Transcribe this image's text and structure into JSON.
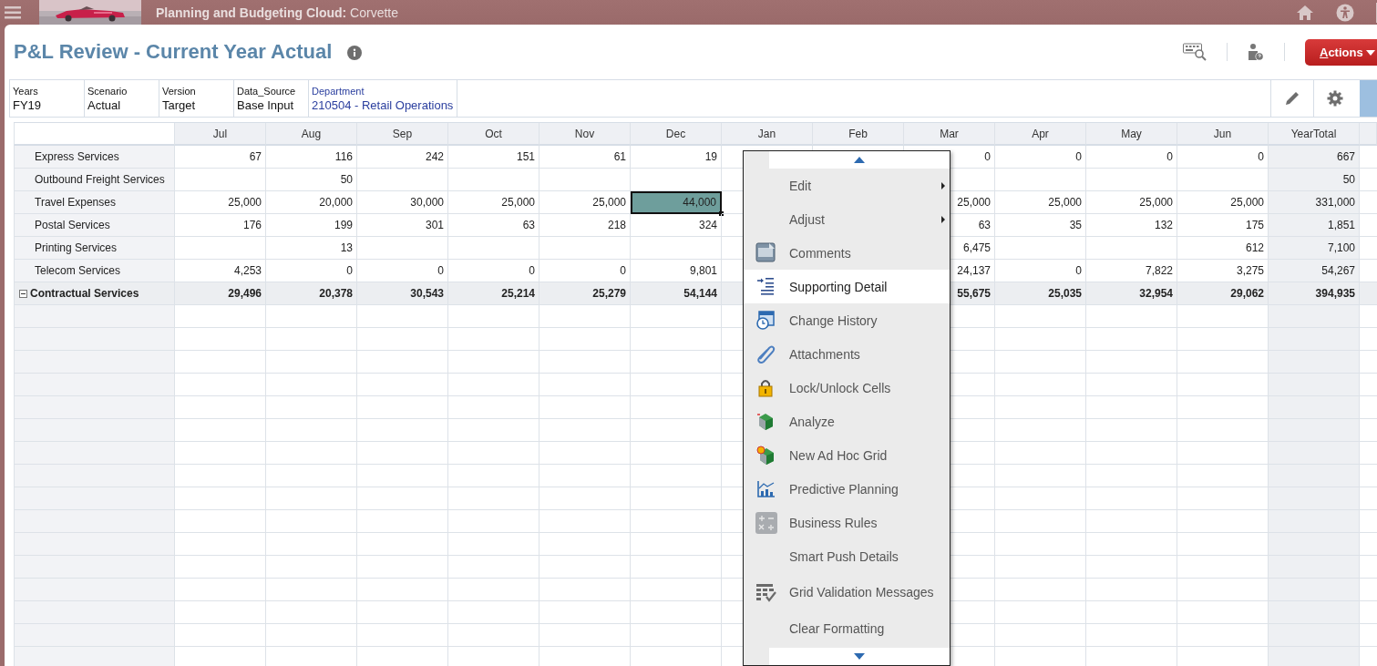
{
  "app_bar": {
    "title": "**Planning and Budgeting Cloud:** Corvette"
  },
  "form": {
    "title": "P&L Review - Current Year Actual",
    "actions_button": "Actions"
  },
  "pov": [
    {
      "label": "Years",
      "value": "FY19",
      "kind": "fixed"
    },
    {
      "label": "Scenario",
      "value": "Actual",
      "kind": "fixed"
    },
    {
      "label": "Version",
      "value": "Target",
      "kind": "fixed"
    },
    {
      "label": "Data_Source",
      "value": "Base Input",
      "kind": "fixed"
    },
    {
      "label": "Department",
      "value": "210504 - Retail Operations",
      "kind": "selectable"
    }
  ],
  "grid": {
    "columns": [
      "Jul",
      "Aug",
      "Sep",
      "Oct",
      "Nov",
      "Dec",
      "Jan",
      "Feb",
      "Mar",
      "Apr",
      "May",
      "Jun",
      "YearTotal"
    ],
    "rows": [
      {
        "label": "Express Services",
        "kind": "member",
        "cells": [
          {
            "value": "67",
            "selected": false
          },
          {
            "value": "116",
            "selected": false
          },
          {
            "value": "242",
            "selected": false
          },
          {
            "value": "151",
            "selected": false
          },
          {
            "value": "61",
            "selected": false
          },
          {
            "value": "19",
            "selected": false
          },
          null,
          null,
          {
            "value": "0",
            "selected": false
          },
          {
            "value": "0",
            "selected": false
          },
          {
            "value": "0",
            "selected": false
          },
          {
            "value": "0",
            "selected": false
          },
          {
            "value": "667",
            "selected": false
          }
        ]
      },
      {
        "label": "Outbound Freight Services",
        "kind": "member",
        "cells": [
          {
            "selected": false
          },
          {
            "value": "50",
            "selected": false
          },
          {
            "selected": false
          },
          {
            "selected": false
          },
          {
            "selected": false
          },
          {
            "selected": false
          },
          null,
          null,
          {
            "selected": false
          },
          {
            "selected": false
          },
          {
            "selected": false
          },
          {
            "selected": false
          },
          {
            "value": "50",
            "selected": false
          }
        ]
      },
      {
        "label": "Travel Expenses",
        "kind": "member",
        "cells": [
          {
            "value": "25,000",
            "selected": false
          },
          {
            "value": "20,000",
            "selected": false
          },
          {
            "value": "30,000",
            "selected": false
          },
          {
            "value": "25,000",
            "selected": false
          },
          {
            "value": "25,000",
            "selected": false
          },
          {
            "value": "44,000",
            "selected": true
          },
          null,
          null,
          {
            "value": "25,000",
            "selected": false
          },
          {
            "value": "25,000",
            "selected": false
          },
          {
            "value": "25,000",
            "selected": false
          },
          {
            "value": "25,000",
            "selected": false
          },
          {
            "value": "331,000",
            "selected": false
          }
        ]
      },
      {
        "label": "Postal Services",
        "kind": "member",
        "cells": [
          {
            "value": "176",
            "selected": false
          },
          {
            "value": "199",
            "selected": false
          },
          {
            "value": "301",
            "selected": false
          },
          {
            "value": "63",
            "selected": false
          },
          {
            "value": "218",
            "selected": false
          },
          {
            "value": "324",
            "selected": false
          },
          null,
          null,
          {
            "value": "63",
            "selected": false
          },
          {
            "value": "35",
            "selected": false
          },
          {
            "value": "132",
            "selected": false
          },
          {
            "value": "175",
            "selected": false
          },
          {
            "value": "1,851",
            "selected": false
          }
        ]
      },
      {
        "label": "Printing Services",
        "kind": "member",
        "cells": [
          {
            "selected": false
          },
          {
            "value": "13",
            "selected": false
          },
          {
            "selected": false
          },
          {
            "selected": false
          },
          {
            "selected": false
          },
          {
            "selected": false
          },
          null,
          null,
          {
            "value": "6,475",
            "selected": false
          },
          {
            "selected": false
          },
          {
            "selected": false
          },
          {
            "value": "612",
            "selected": false
          },
          {
            "value": "7,100",
            "selected": false
          }
        ]
      },
      {
        "label": "Telecom Services",
        "kind": "member",
        "cells": [
          {
            "value": "4,253",
            "selected": false
          },
          {
            "value": "0",
            "selected": false
          },
          {
            "value": "0",
            "selected": false
          },
          {
            "value": "0",
            "selected": false
          },
          {
            "value": "0",
            "selected": false
          },
          {
            "value": "9,801",
            "selected": false
          },
          null,
          null,
          {
            "value": "24,137",
            "selected": false
          },
          {
            "value": "0",
            "selected": false
          },
          {
            "value": "7,822",
            "selected": false
          },
          {
            "value": "3,275",
            "selected": false
          },
          {
            "value": "54,267",
            "selected": false
          }
        ]
      },
      {
        "label": "Contractual Services",
        "kind": "total",
        "expanded": true,
        "cells": [
          {
            "value": "29,496",
            "selected": false
          },
          {
            "value": "20,378",
            "selected": false
          },
          {
            "value": "30,543",
            "selected": false
          },
          {
            "value": "25,214",
            "selected": false
          },
          {
            "value": "25,279",
            "selected": false
          },
          {
            "value": "54,144",
            "selected": false
          },
          null,
          null,
          {
            "value": "55,675",
            "selected": false
          },
          {
            "value": "25,035",
            "selected": false
          },
          {
            "value": "32,954",
            "selected": false
          },
          {
            "value": "29,062",
            "selected": false
          },
          {
            "value": "394,935",
            "selected": false
          }
        ]
      }
    ]
  },
  "context_menu": {
    "items": [
      {
        "label": "Edit",
        "submenu": true,
        "selected": false
      },
      {
        "label": "Adjust",
        "submenu": true,
        "selected": false
      },
      {
        "label": "Comments",
        "submenu": false,
        "selected": false
      },
      {
        "label": "Supporting Detail",
        "submenu": false,
        "selected": true
      },
      {
        "label": "Change History",
        "submenu": false,
        "selected": false
      },
      {
        "label": "Attachments",
        "submenu": false,
        "selected": false
      },
      {
        "label": "Lock/Unlock Cells",
        "submenu": false,
        "selected": false
      },
      {
        "label": "Analyze",
        "submenu": false,
        "selected": false
      },
      {
        "label": "New Ad Hoc Grid",
        "submenu": false,
        "selected": false
      },
      {
        "label": "Predictive Planning",
        "submenu": false,
        "selected": false
      },
      {
        "label": "Business Rules",
        "submenu": false,
        "selected": false
      },
      {
        "label": "Smart Push Details",
        "submenu": false,
        "selected": false
      },
      {
        "label": "Grid Validation Messages",
        "submenu": false,
        "selected": false
      },
      {
        "label": "Clear Formatting",
        "submenu": false,
        "selected": false
      }
    ]
  }
}
